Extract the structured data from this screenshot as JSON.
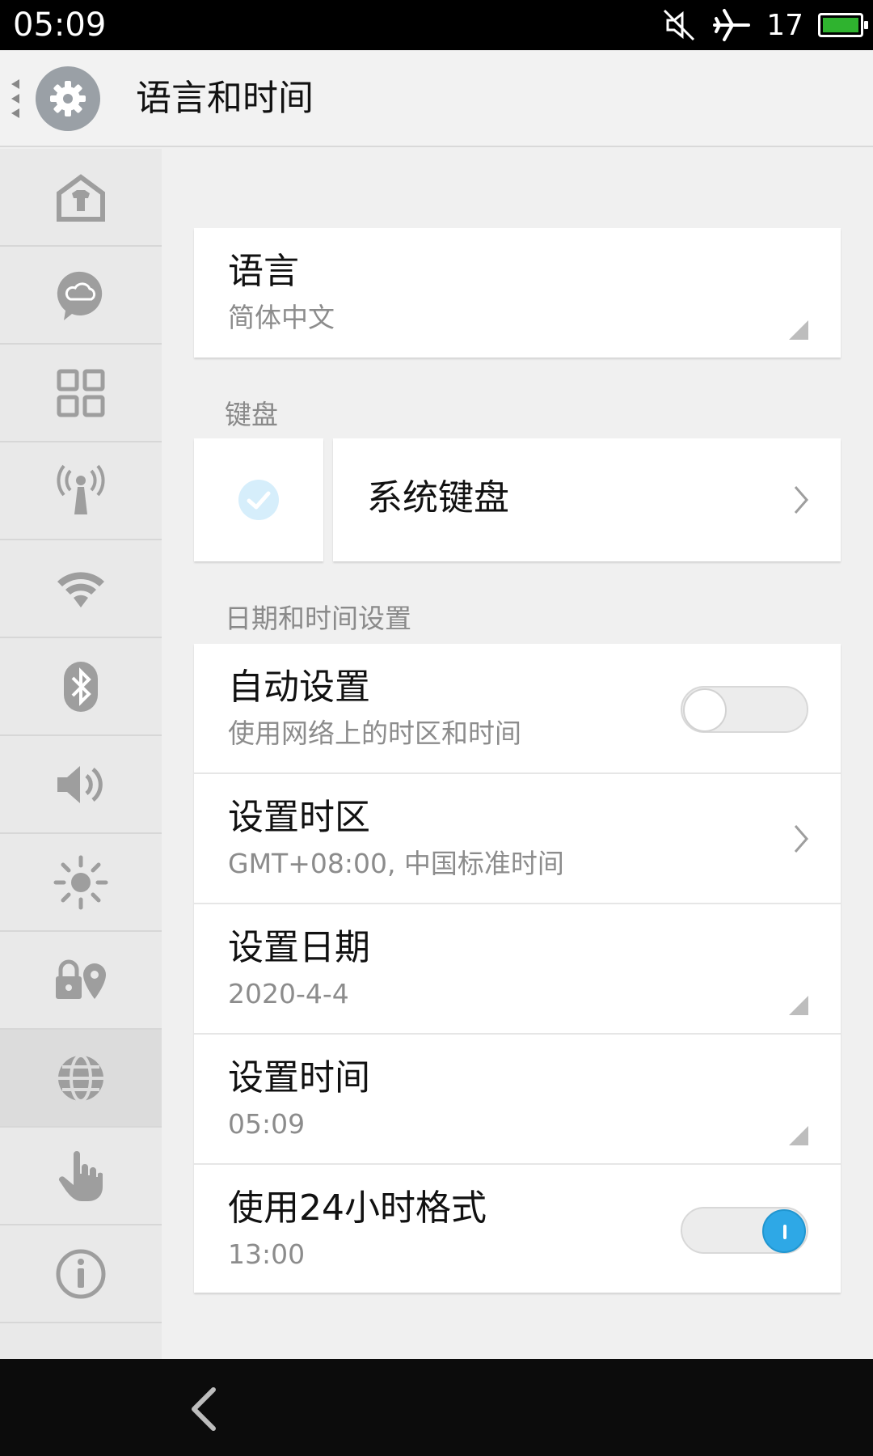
{
  "status_bar": {
    "time": "05:09",
    "signal_number": "17"
  },
  "header": {
    "title": "语言和时间"
  },
  "sidebar": {
    "items": [
      {
        "icon": "theme-shirt-icon"
      },
      {
        "icon": "cloud-chat-icon"
      },
      {
        "icon": "apps-grid-icon"
      },
      {
        "icon": "antenna-icon"
      },
      {
        "icon": "wifi-icon"
      },
      {
        "icon": "bluetooth-icon"
      },
      {
        "icon": "volume-icon"
      },
      {
        "icon": "brightness-icon"
      },
      {
        "icon": "lock-location-icon"
      },
      {
        "icon": "globe-icon",
        "active": true
      },
      {
        "icon": "hand-gesture-icon"
      },
      {
        "icon": "info-icon"
      }
    ]
  },
  "language": {
    "label": "语言",
    "value": "简体中文"
  },
  "keyboard": {
    "section_title": "键盘",
    "label": "系统键盘"
  },
  "datetime": {
    "section_title": "日期和时间设置",
    "auto": {
      "label": "自动设置",
      "sub": "使用网络上的时区和时间",
      "enabled": false
    },
    "timezone": {
      "label": "设置时区",
      "sub": "GMT+08:00, 中国标准时间"
    },
    "date": {
      "label": "设置日期",
      "sub": "2020-4-4"
    },
    "time": {
      "label": "设置时间",
      "sub": "05:09"
    },
    "format24": {
      "label": "使用24小时格式",
      "sub": "13:00",
      "enabled": true
    }
  },
  "colors": {
    "accent": "#2ea8e6",
    "battery": "#2fb32f"
  }
}
